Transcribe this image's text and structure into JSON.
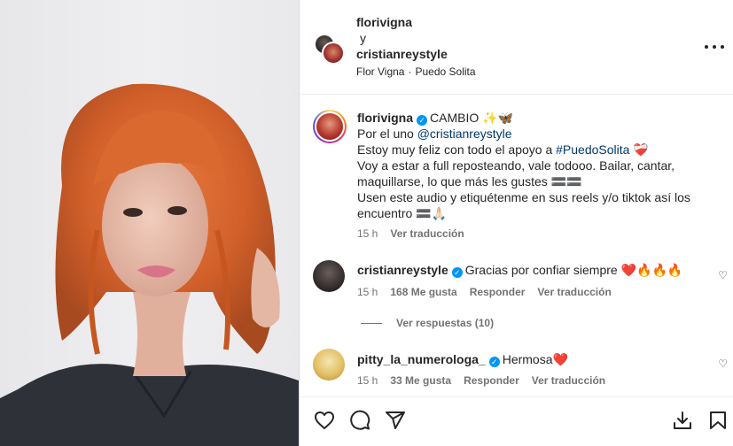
{
  "header": {
    "user1": "florivigna",
    "conj": "y",
    "user2": "cristianreystyle",
    "sub_artist": "Flor Vigna",
    "sub_sep": "·",
    "sub_song": "Puedo Solita"
  },
  "caption": {
    "username": "florivigna",
    "line1": "CAMBIO ✨🦋",
    "line2_pre": "Por el uno ",
    "line2_mention": "@cristianreystyle",
    "line3_pre": "Estoy muy feliz con todo el apoyo a ",
    "line3_tag": "#PuedoSolita",
    "line3_post": " ❤️‍🩹",
    "line4": "Voy a estar a full reposteando, vale todooo. Bailar, cantar, maquillarse, lo que más les gustes 🟰🟰",
    "line5": "Usen este audio y etiquétenme en sus reels y/o tiktok así los encuentro 🟰🙏🏻",
    "time": "15 h",
    "translate": "Ver traducción"
  },
  "comments": [
    {
      "username": "cristianreystyle",
      "text": "Gracias por confiar siempre ❤️🔥🔥🔥",
      "time": "15 h",
      "likes": "168 Me gusta",
      "reply": "Responder",
      "translate": "Ver traducción"
    },
    {
      "username": "pitty_la_numerologa_",
      "text": "Hermosa❤️",
      "time": "15 h",
      "likes": "33 Me gusta",
      "reply": "Responder",
      "translate": "Ver traducción"
    }
  ],
  "view_replies": "Ver respuestas (10)",
  "icons": {
    "more": "more-options-icon",
    "like": "heart-icon",
    "comment": "comment-icon",
    "share": "send-icon",
    "download": "download-icon",
    "save": "bookmark-icon"
  }
}
